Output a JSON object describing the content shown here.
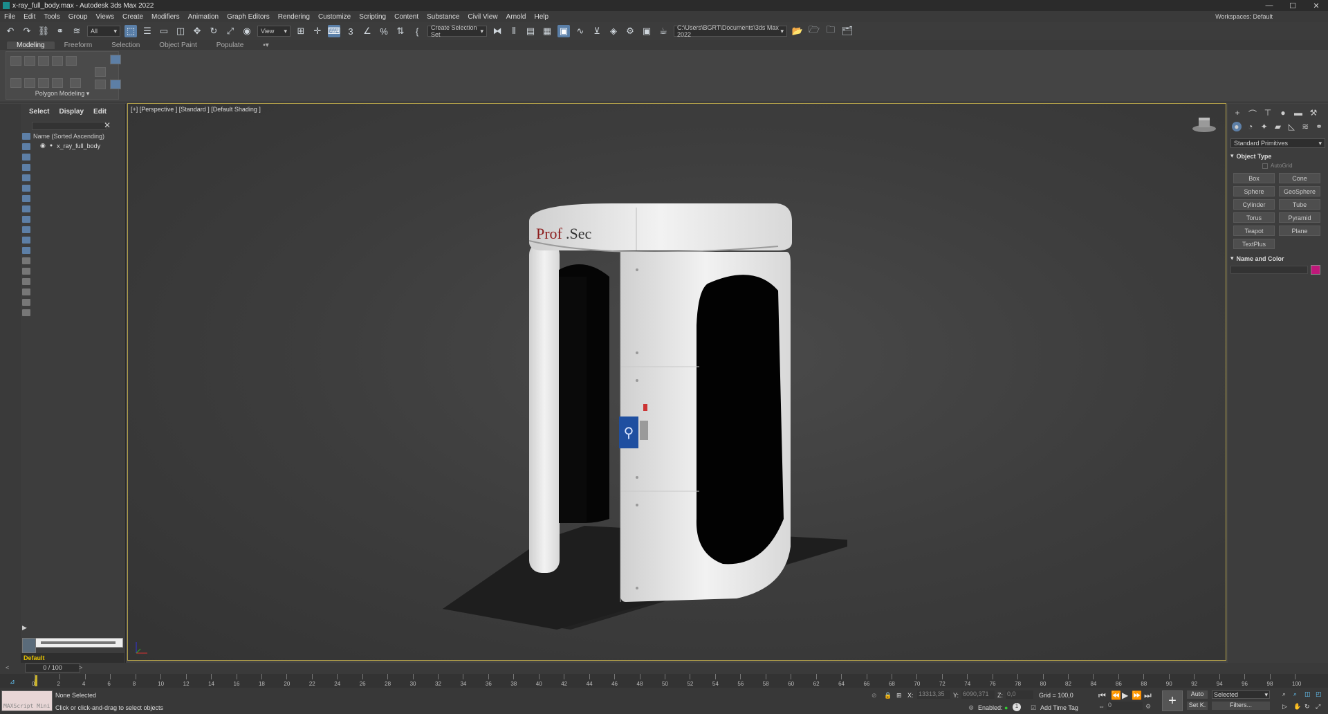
{
  "window": {
    "title": "x-ray_full_body.max - Autodesk 3ds Max 2022",
    "min": "—",
    "max": "☐",
    "close": "✕"
  },
  "menu": [
    "File",
    "Edit",
    "Tools",
    "Group",
    "Views",
    "Create",
    "Modifiers",
    "Animation",
    "Graph Editors",
    "Rendering",
    "Customize",
    "Scripting",
    "Content",
    "Substance",
    "Civil View",
    "Arnold",
    "Help"
  ],
  "workspace": {
    "label": "Workspaces:",
    "value": "Default"
  },
  "toolbar": {
    "filter_value": "All",
    "refcoord_value": "View",
    "selection_set": "Create Selection Set",
    "project_path": "C:\\Users\\BGRT\\Documents\\3ds Max 2022"
  },
  "ribbon": {
    "tabs": [
      "Modeling",
      "Freeform",
      "Selection",
      "Object Paint",
      "Populate"
    ],
    "active_tab": "Modeling",
    "panel_label": "Polygon Modeling"
  },
  "explorer": {
    "tabs": [
      "Select",
      "Display",
      "Edit"
    ],
    "column_header": "Name (Sorted Ascending)",
    "items": [
      "x_ray_full_body"
    ],
    "layer": "Default"
  },
  "viewport": {
    "label": "[+] [Perspective ] [Standard ] [Default Shading ]",
    "model_brand": "Prof.Sec",
    "brand_color": "#8b1a1a"
  },
  "command_panel": {
    "category": "Standard Primitives",
    "rollout_object_type": "Object Type",
    "autogrid": "AutoGrid",
    "buttons": [
      "Box",
      "Cone",
      "Sphere",
      "GeoSphere",
      "Cylinder",
      "Tube",
      "Torus",
      "Pyramid",
      "Teapot",
      "Plane",
      "TextPlus"
    ],
    "rollout_name_color": "Name and Color",
    "swatch_color": "#c0187a"
  },
  "timeline": {
    "frame_display": "0 / 100",
    "ticks": [
      "0",
      "2",
      "4",
      "6",
      "8",
      "10",
      "12",
      "14",
      "16",
      "18",
      "20",
      "22",
      "24",
      "26",
      "28",
      "30",
      "32",
      "34",
      "36",
      "38",
      "40",
      "42",
      "44",
      "46",
      "48",
      "50",
      "52",
      "54",
      "56",
      "58",
      "60",
      "62",
      "64",
      "66",
      "68",
      "70",
      "72",
      "74",
      "76",
      "78",
      "80",
      "82",
      "84",
      "86",
      "88",
      "90",
      "92",
      "94",
      "96",
      "98",
      "100"
    ]
  },
  "status": {
    "maxscript": "MAXScript Mini",
    "selection": "None Selected",
    "prompt": "Click or click-and-drag to select objects",
    "x_label": "X:",
    "x_value": "13313,35",
    "y_label": "Y:",
    "y_value": "6090,371",
    "z_label": "Z:",
    "z_value": "0,0",
    "grid": "Grid = 100,0",
    "enabled": "Enabled:",
    "add_time_tag": "Add Time Tag",
    "auto": "Auto",
    "set_key_mode": "Selected",
    "set_k": "Set K.",
    "filters": "Filters...",
    "frame": "0"
  }
}
